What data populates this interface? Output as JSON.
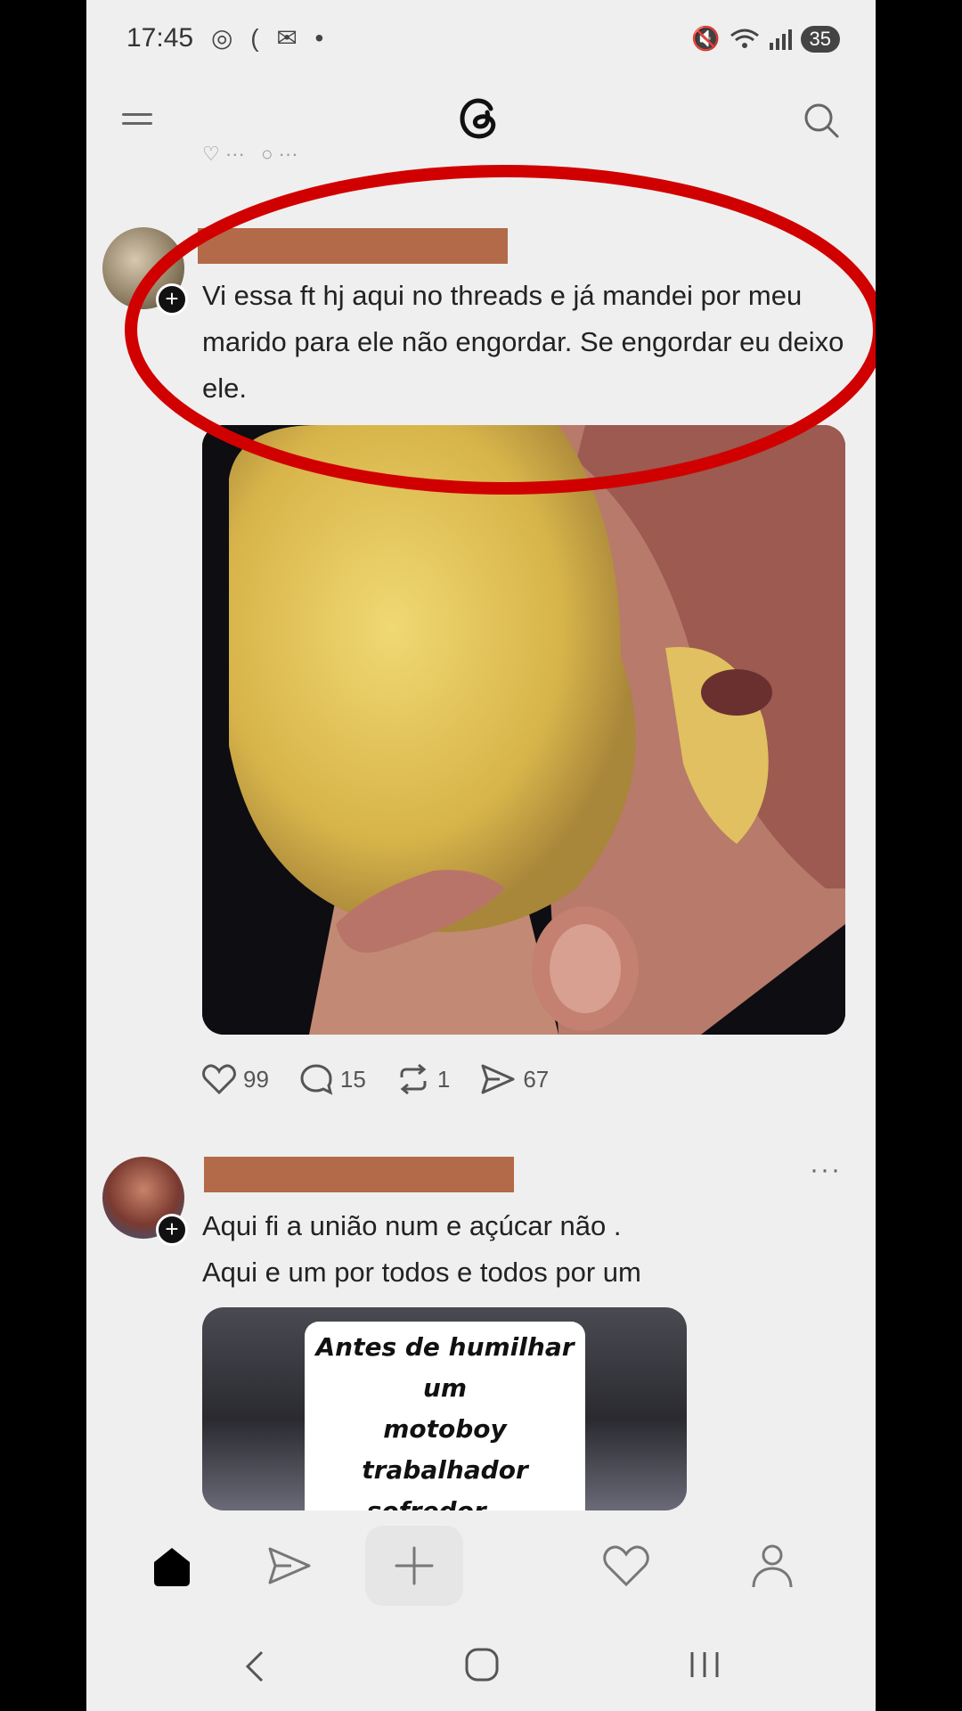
{
  "status_bar": {
    "time": "17:45",
    "left_icons": "◎ ( ✉ •",
    "battery": "35"
  },
  "app": {
    "logo_icon": "threads-logo-icon",
    "menu_icon": "menu-icon",
    "search_icon": "search-icon"
  },
  "posts": [
    {
      "text": "Vi essa ft hj aqui no threads e já mandei por meu marido para ele não engordar. Se engordar eu deixo ele.",
      "likes": "99",
      "replies": "15",
      "reposts": "1",
      "shares": "67"
    },
    {
      "line1": "Aqui fi a união num e açúcar não .",
      "line2": "Aqui e um por todos e todos por um",
      "video_caption_1": "Antes de humilhar um",
      "video_caption_2": "motoboy trabalhador",
      "video_caption_3": "sofredor ..."
    }
  ],
  "colors": {
    "annotation": "#d10000",
    "redaction": "#b36a48",
    "background": "#efefef"
  }
}
